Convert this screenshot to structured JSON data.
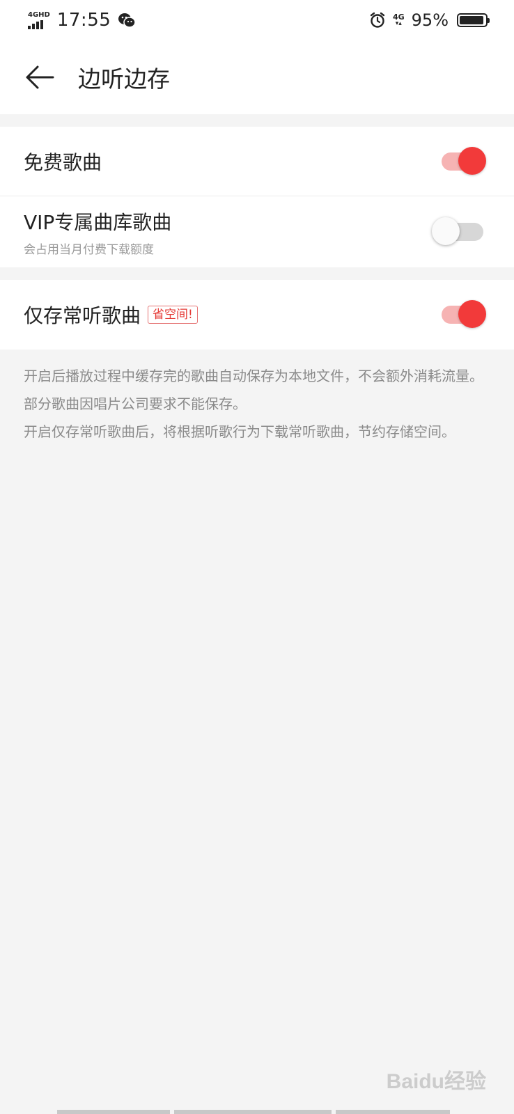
{
  "status_bar": {
    "network": "4GHD",
    "time": "17:55",
    "sim_network": "4G",
    "battery_percent": "95%",
    "battery_level": 0.95,
    "icons": [
      "signal-icon",
      "wechat-icon",
      "alarm-icon",
      "battery-icon"
    ]
  },
  "header": {
    "title": "边听边存",
    "back_icon": "back-arrow-icon"
  },
  "settings": {
    "free_songs": {
      "label": "免费歌曲",
      "enabled": true
    },
    "vip_songs": {
      "label": "VIP专属曲库歌曲",
      "sublabel": "会占用当月付费下载额度",
      "enabled": false
    },
    "frequent_only": {
      "label": "仅存常听歌曲",
      "tag": "省空间!",
      "enabled": true
    }
  },
  "description": {
    "line1": "开启后播放过程中缓存完的歌曲自动保存为本地文件，不会额外消耗流量。",
    "line2": "部分歌曲因唱片公司要求不能保存。",
    "line3": "开启仅存常听歌曲后，将根据听歌行为下载常听歌曲，节约存储空间。"
  },
  "watermark": {
    "text": "Baidu经验"
  },
  "colors": {
    "accent": "#f23a3a",
    "accent_track": "#f6b3b3",
    "off_track": "#d7d7d7",
    "background": "#f4f4f4",
    "tag_red": "#e53935"
  }
}
